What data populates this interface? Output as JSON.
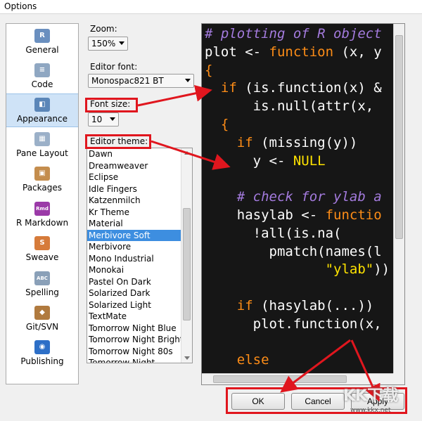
{
  "window": {
    "title": "Options"
  },
  "sidebar": {
    "items": [
      {
        "label": "General",
        "icon": "r-logo-icon",
        "color": "#6a8fbf",
        "glyph": "R"
      },
      {
        "label": "Code",
        "icon": "code-document-icon",
        "color": "#8fa7c2",
        "glyph": "≡"
      },
      {
        "label": "Appearance",
        "icon": "paint-bucket-icon",
        "color": "#5b86b8",
        "glyph": "◧"
      },
      {
        "label": "Pane Layout",
        "icon": "pane-layout-icon",
        "color": "#9bb0c8",
        "glyph": "▦"
      },
      {
        "label": "Packages",
        "icon": "packages-box-icon",
        "color": "#c48d4d",
        "glyph": "▣"
      },
      {
        "label": "R Markdown",
        "icon": "rmd-icon",
        "color": "#9b3aa8",
        "glyph": "Rmd"
      },
      {
        "label": "Sweave",
        "icon": "sweave-icon",
        "color": "#d67b3a",
        "glyph": "S"
      },
      {
        "label": "Spelling",
        "icon": "spelling-abc-icon",
        "color": "#8aa0b8",
        "glyph": "ABC"
      },
      {
        "label": "Git/SVN",
        "icon": "git-box-icon",
        "color": "#b07a3e",
        "glyph": "◆"
      },
      {
        "label": "Publishing",
        "icon": "publishing-icon",
        "color": "#2d6fc7",
        "glyph": "◉"
      }
    ],
    "selected_index": 2
  },
  "settings": {
    "zoom_label": "Zoom:",
    "zoom_value": "150%",
    "editor_font_label": "Editor font:",
    "editor_font_value": "Monospac821 BT",
    "font_size_label": "Font size:",
    "font_size_value": "10",
    "editor_theme_label": "Editor theme:",
    "themes": [
      "Dawn",
      "Dreamweaver",
      "Eclipse",
      "Idle Fingers",
      "Katzenmilch",
      "Kr Theme",
      "Material",
      "Merbivore Soft",
      "Merbivore",
      "Mono Industrial",
      "Monokai",
      "Pastel On Dark",
      "Solarized Dark",
      "Solarized Light",
      "TextMate",
      "Tomorrow Night Blue",
      "Tomorrow Night Bright",
      "Tomorrow Night 80s",
      "Tomorrow Night"
    ],
    "selected_theme": "Merbivore Soft"
  },
  "preview": {
    "lines": [
      [
        {
          "t": "# plotting of R object",
          "c": "cm"
        }
      ],
      [
        {
          "t": "plot <- ",
          "c": "pl"
        },
        {
          "t": "function",
          "c": "kw"
        },
        {
          "t": " (x, y",
          "c": "pl"
        }
      ],
      [
        {
          "t": "{",
          "c": "kw"
        }
      ],
      [
        {
          "t": "  if",
          "c": "kw"
        },
        {
          "t": " (is.function(x) &",
          "c": "pl"
        }
      ],
      [
        {
          "t": "      is.null(attr(x,",
          "c": "pl"
        }
      ],
      [
        {
          "t": "  {",
          "c": "kw"
        }
      ],
      [
        {
          "t": "    if",
          "c": "kw"
        },
        {
          "t": " (missing(y))",
          "c": "pl"
        }
      ],
      [
        {
          "t": "      y <- ",
          "c": "pl"
        },
        {
          "t": "NULL",
          "c": "st"
        }
      ],
      [
        {
          "t": "",
          "c": "pl"
        }
      ],
      [
        {
          "t": "    # check for ylab a",
          "c": "cm"
        }
      ],
      [
        {
          "t": "    hasylab <- ",
          "c": "pl"
        },
        {
          "t": "functio",
          "c": "kw"
        }
      ],
      [
        {
          "t": "      !all(is.na(",
          "c": "pl"
        }
      ],
      [
        {
          "t": "        pmatch(names(l",
          "c": "pl"
        }
      ],
      [
        {
          "t": "               ",
          "c": "pl"
        },
        {
          "t": "\"ylab\"",
          "c": "st"
        },
        {
          "t": "))",
          "c": "pl"
        }
      ],
      [
        {
          "t": "",
          "c": "pl"
        }
      ],
      [
        {
          "t": "    if",
          "c": "kw"
        },
        {
          "t": " (hasylab(...))",
          "c": "pl"
        }
      ],
      [
        {
          "t": "      plot.function(x,",
          "c": "pl"
        }
      ],
      [
        {
          "t": "",
          "c": "pl"
        }
      ],
      [
        {
          "t": "    else",
          "c": "kw"
        }
      ],
      [
        {
          "t": "      ",
          "c": "pl"
        }
      ]
    ]
  },
  "buttons": {
    "ok": "OK",
    "cancel": "Cancel",
    "apply": "Apply"
  },
  "annotation_color": "#e0161e",
  "watermark": {
    "text": "KK下载",
    "sub": "www.kkx.net"
  }
}
